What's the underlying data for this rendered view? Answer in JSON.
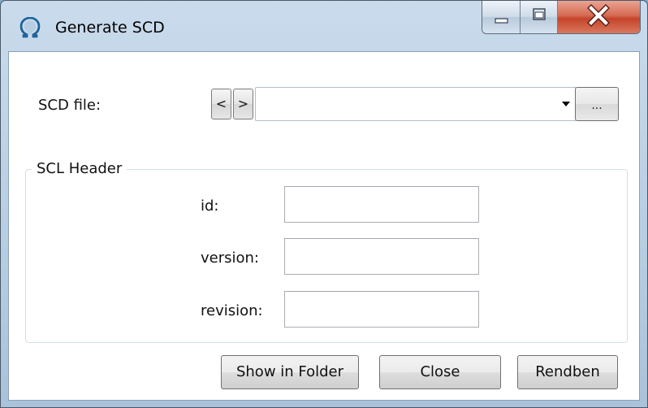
{
  "window": {
    "title": "Generate SCD",
    "app_icon": "omega-icon",
    "caption_buttons": [
      "minimize-icon",
      "maximize-icon",
      "close-icon"
    ]
  },
  "scd_file": {
    "label": "SCD file:",
    "prev_label": "<",
    "next_label": ">",
    "value": "",
    "browse_label": "..."
  },
  "scl_header": {
    "legend": "SCL Header",
    "id_label": "id:",
    "id_value": "",
    "version_label": "version:",
    "version_value": "",
    "revision_label": "revision:",
    "revision_value": ""
  },
  "footer": {
    "show_in_folder_label": "Show in Folder",
    "close_label": "Close",
    "rendben_label": "Rendben"
  },
  "colors": {
    "titlebar": "#b7cde2",
    "close_button": "#c4442b",
    "icon_blue": "#1b6aa6"
  }
}
